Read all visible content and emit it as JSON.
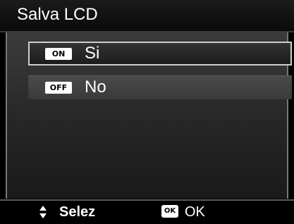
{
  "header": {
    "title": "Salva LCD"
  },
  "options": [
    {
      "badge": "ON",
      "label": "Si",
      "selected": true
    },
    {
      "badge": "OFF",
      "label": "No",
      "selected": false
    }
  ],
  "footer": {
    "select_icon": "up-down-arrows-icon",
    "select_label": "Selez",
    "ok_icon_text": "OK",
    "ok_label": "OK"
  },
  "colors": {
    "background": "#000000",
    "text": "#ffffff",
    "selection_border": "#cfcfcf"
  }
}
